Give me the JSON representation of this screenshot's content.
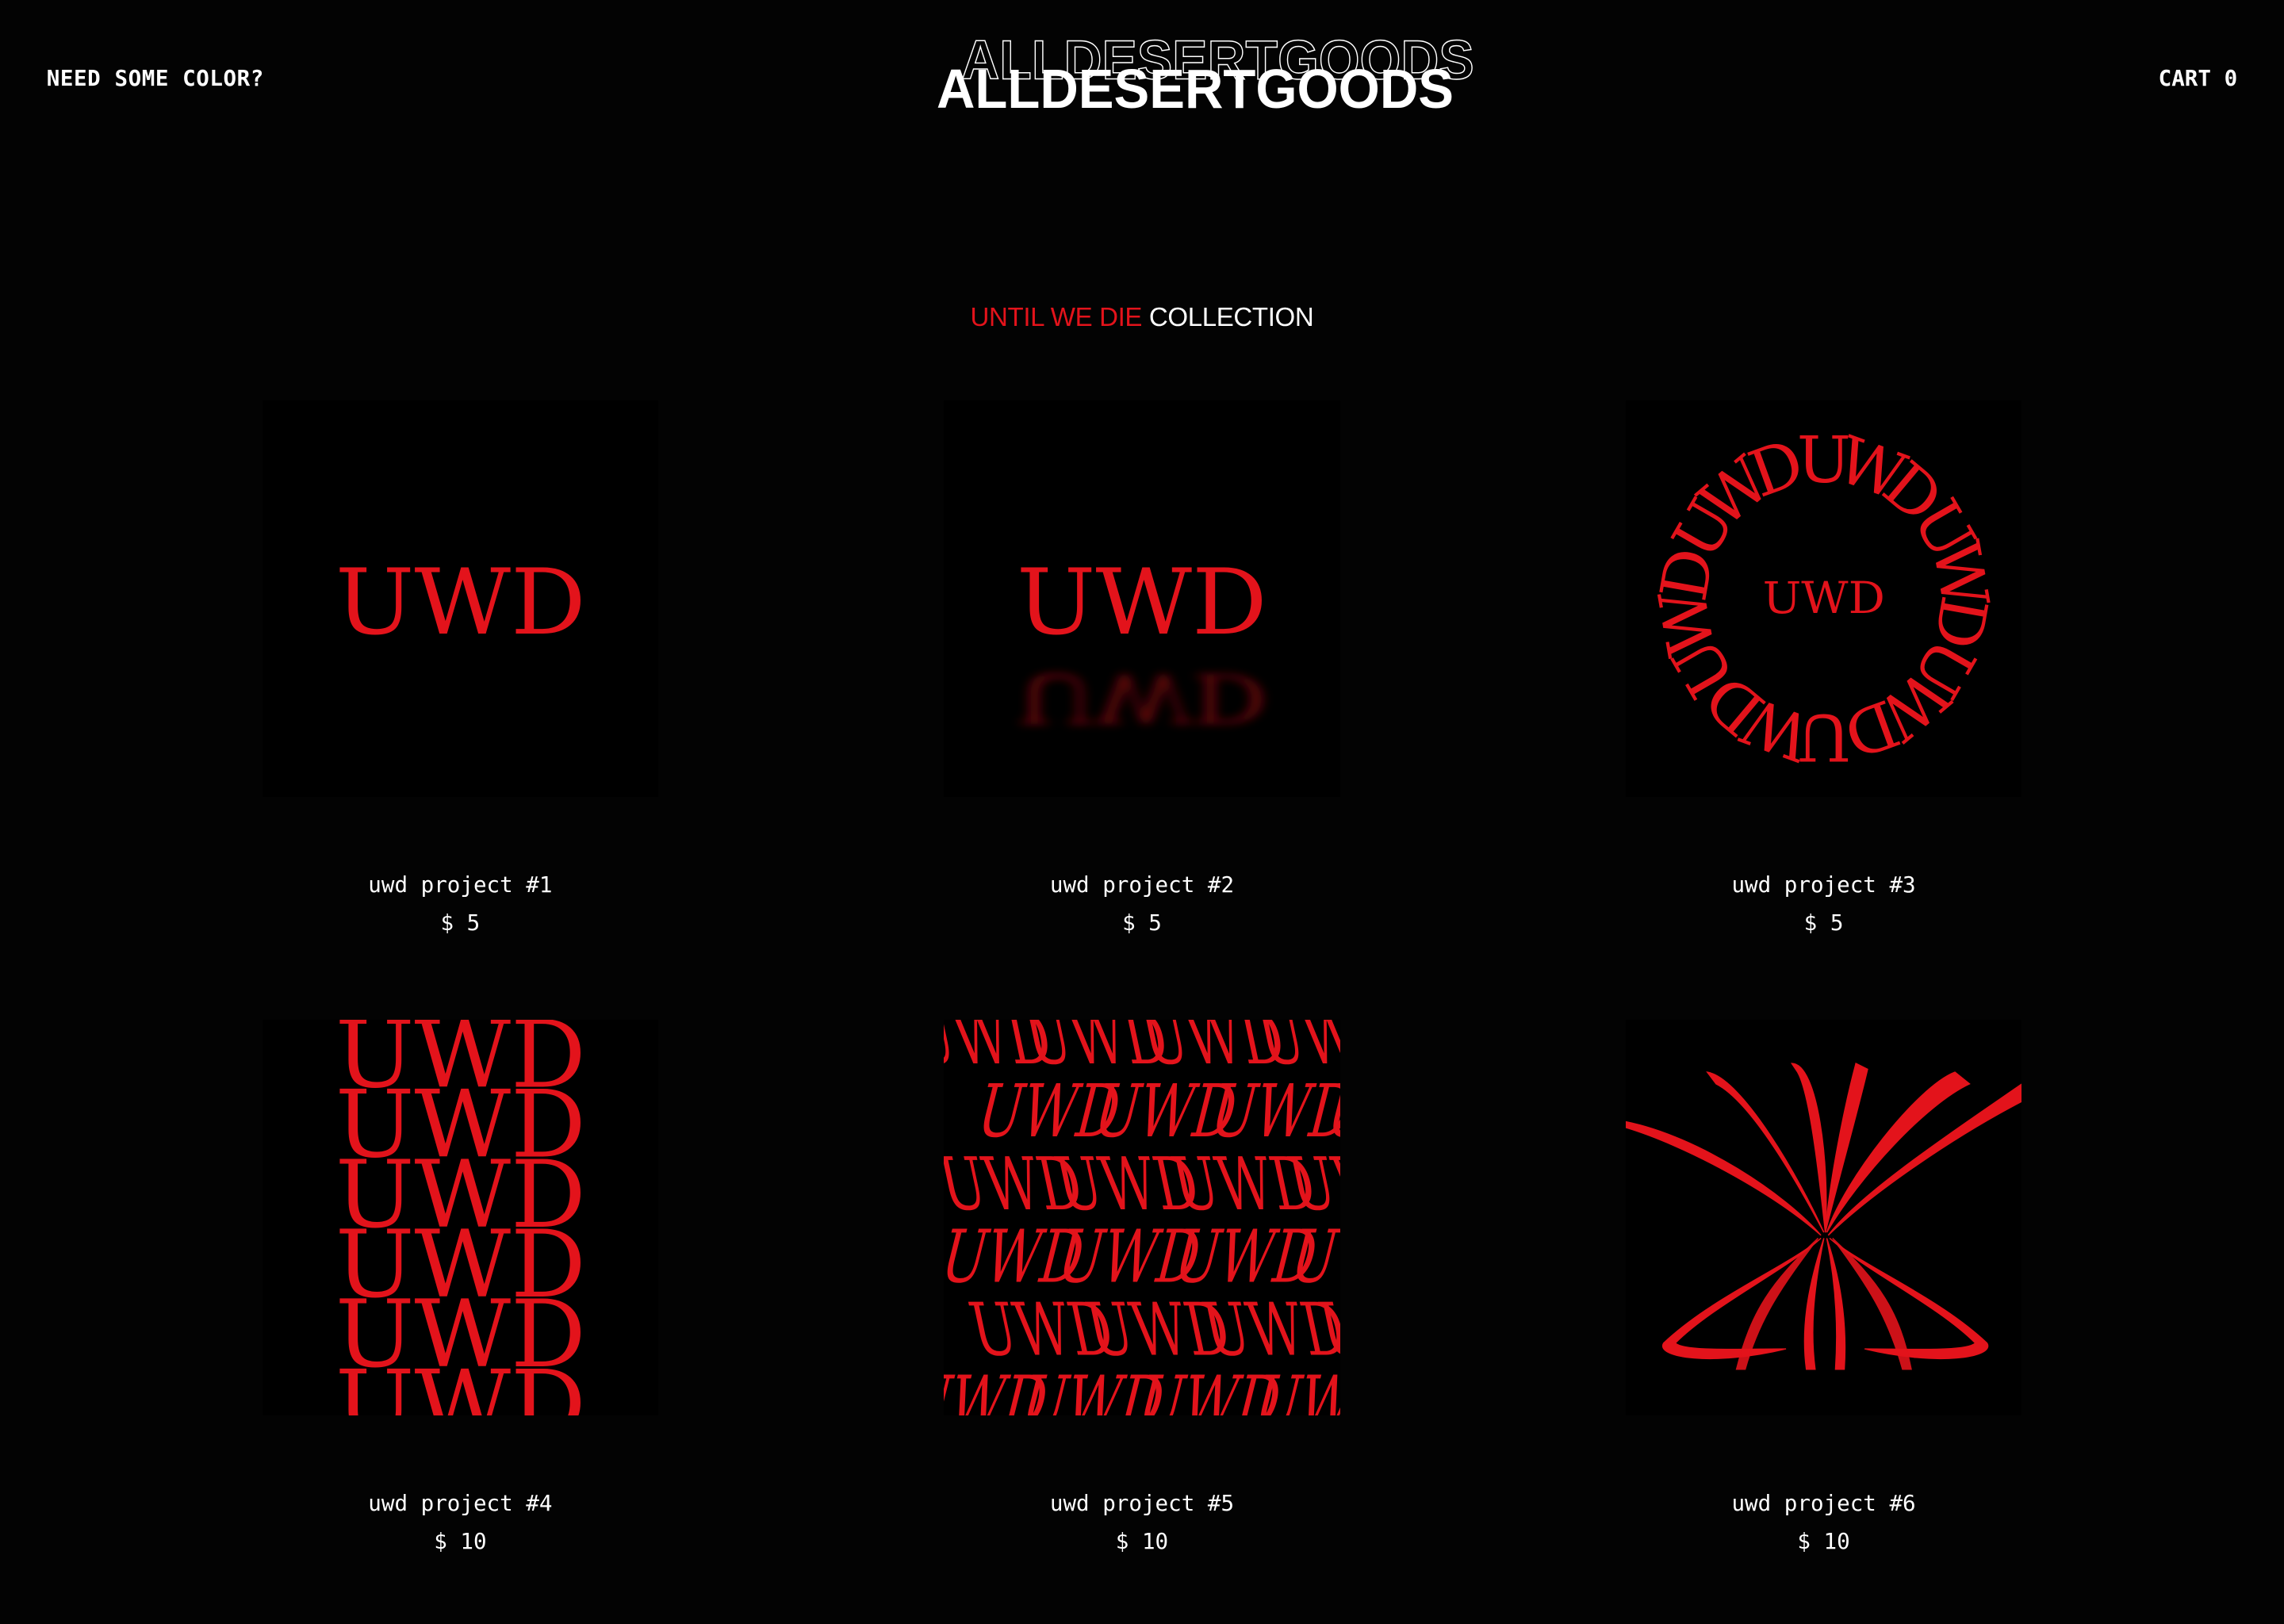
{
  "header": {
    "color_link": "NEED SOME COLOR?",
    "logo_text": "ALLDESERTGOODS",
    "cart_label": "CART",
    "cart_count": "0"
  },
  "collection": {
    "title_accent": "UNTIL WE DIE",
    "title_rest": "COLLECTION"
  },
  "thumb_text": "UWD",
  "colors": {
    "background": "#030303",
    "accent": "#e3131b",
    "text": "#ffffff"
  },
  "products": [
    {
      "name": "uwd project #1",
      "price": "$ 5"
    },
    {
      "name": "uwd project #2",
      "price": "$ 5"
    },
    {
      "name": "uwd project #3",
      "price": "$ 5"
    },
    {
      "name": "uwd project #4",
      "price": "$ 10"
    },
    {
      "name": "uwd project #5",
      "price": "$ 10"
    },
    {
      "name": "uwd project #6",
      "price": "$ 10"
    }
  ]
}
